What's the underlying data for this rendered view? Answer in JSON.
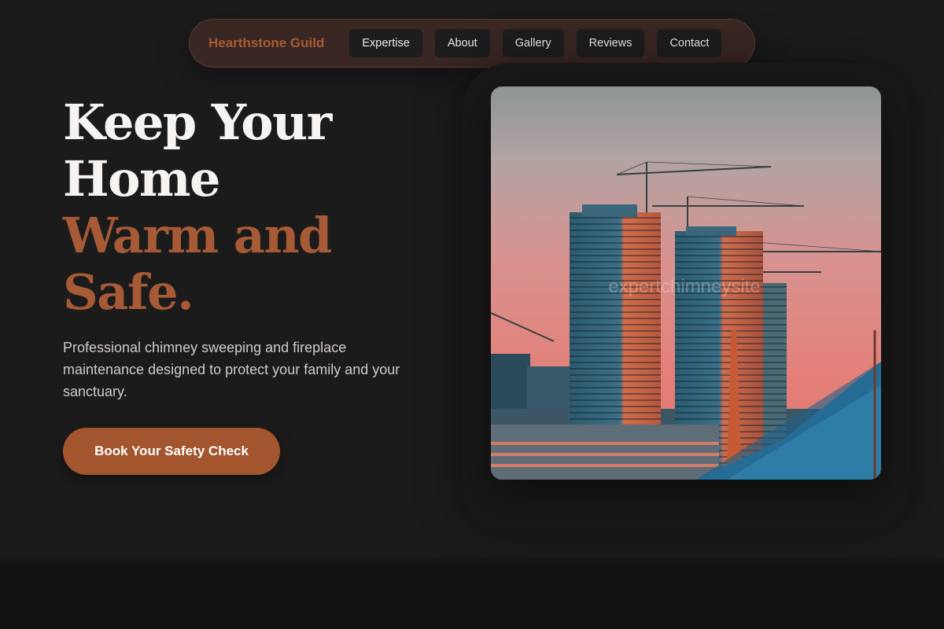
{
  "nav": {
    "brand": "Hearthstone Guild",
    "links": [
      "Expertise",
      "About",
      "Gallery",
      "Reviews",
      "Contact"
    ]
  },
  "hero": {
    "headline_lines": [
      "Keep Your",
      "Home"
    ],
    "accent_lines": [
      "Warm and",
      "Safe."
    ],
    "subtitle": "Professional chimney sweeping and fireplace maintenance designed to protect your family and your sanctuary.",
    "cta_label": "Book Your Safety Check"
  },
  "image": {
    "subject": "construction-cranes-high-rise-at-dusk",
    "watermark": "expertchimneysite"
  },
  "colors": {
    "background": "#1c1b1b",
    "nav_background": "#3a2622",
    "accent": "#a65a36",
    "cta": "#a3552e",
    "button": "#1e1d1d",
    "text": "#f6f3f0",
    "muted_text": "#cfcac6",
    "footer": "#121212"
  }
}
